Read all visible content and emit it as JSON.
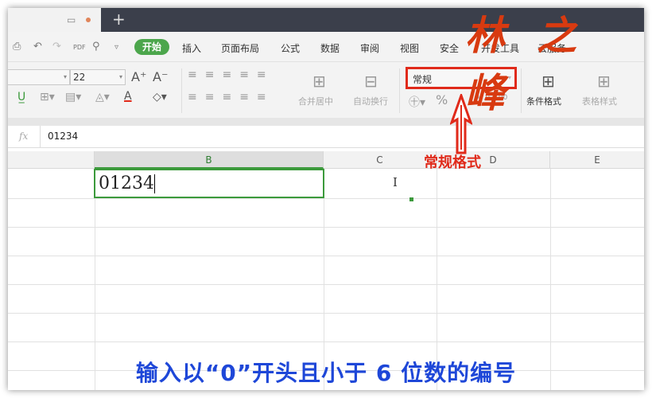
{
  "tabbar": {
    "new_tab": "+"
  },
  "menu": {
    "start": "开始",
    "items": [
      "插入",
      "页面布局",
      "公式",
      "数据",
      "审阅",
      "视图",
      "安全",
      "开发工具",
      "云服务"
    ]
  },
  "toolbar": {
    "font_size": "22",
    "merge_label": "合并居中",
    "wrap_label": "自动换行",
    "number_format": "常规",
    "cond_format": "条件格式",
    "table_style": "表格样式",
    "percent": "%"
  },
  "formula_bar": {
    "fx": "fx",
    "value": "01234"
  },
  "columns": [
    "B",
    "C",
    "D",
    "E"
  ],
  "selected_column": "B",
  "cell": {
    "ref": "B1",
    "value": "01234"
  },
  "annotation": {
    "label": "常规格式",
    "caption": "输入以“0”开头且小于 6 位数的编号"
  },
  "logo": "林之峰",
  "colors": {
    "accent": "#4ca64c",
    "highlight": "#e02a1a",
    "caption": "#1e47d8"
  }
}
